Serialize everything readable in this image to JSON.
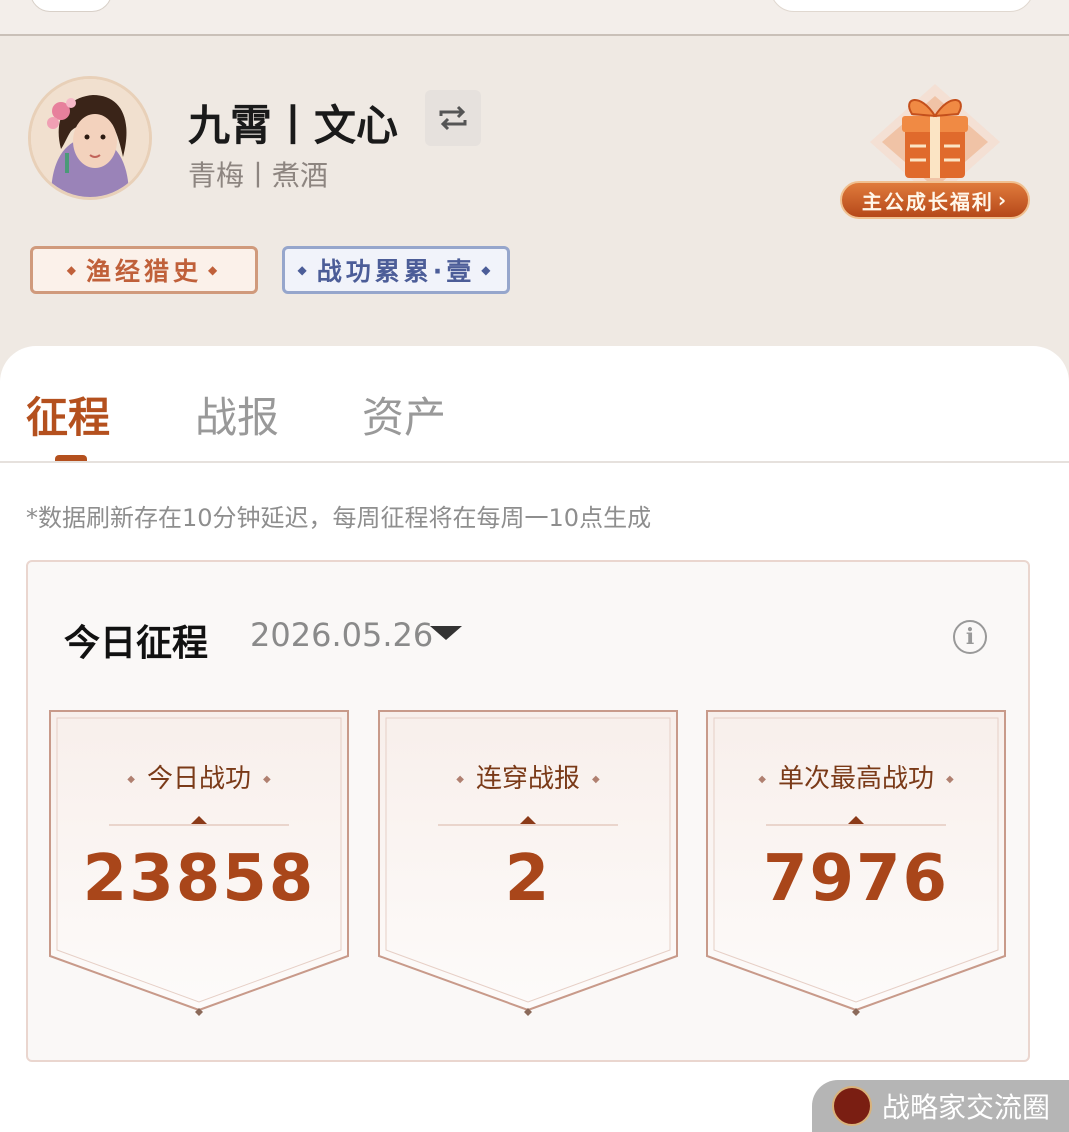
{
  "profile": {
    "name": "九霄丨文心",
    "subtitle": "青梅丨煮酒",
    "badges": [
      {
        "label": "渔经猎史"
      },
      {
        "label": "战功累累·壹"
      }
    ]
  },
  "gift": {
    "label": "主公成长福利",
    "icon": "gift-box-icon"
  },
  "tabs": [
    {
      "label": "征程",
      "active": true
    },
    {
      "label": "战报",
      "active": false
    },
    {
      "label": "资产",
      "active": false
    }
  ],
  "notice": "*数据刷新存在10分钟延迟，每周征程将在每周一10点生成",
  "today": {
    "title": "今日征程",
    "date": "2026.05.26",
    "stats": [
      {
        "label": "今日战功",
        "value": "23858"
      },
      {
        "label": "连穿战报",
        "value": "2"
      },
      {
        "label": "单次最高战功",
        "value": "7976"
      }
    ]
  },
  "watermark": {
    "text": "战略家交流圈"
  },
  "colors": {
    "accent": "#b4501e",
    "background": "#efe9e3"
  }
}
